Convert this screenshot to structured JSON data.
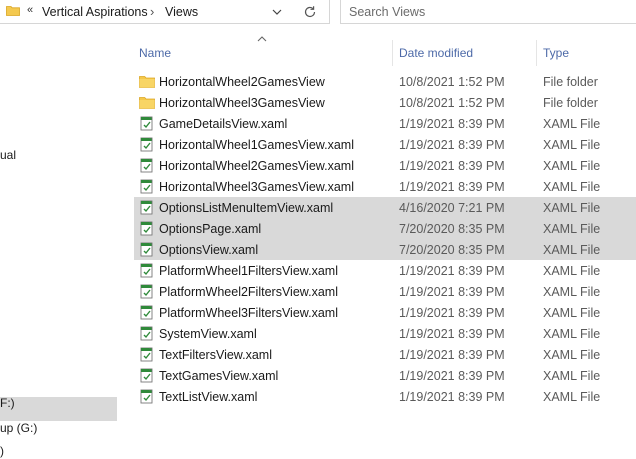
{
  "address": {
    "lead": "«",
    "crumbs": [
      "Vertical Aspirations",
      "Views"
    ],
    "separator": "›"
  },
  "search": {
    "placeholder": "Search Views"
  },
  "nav": {
    "partial_items": [
      {
        "label": "ual"
      },
      {
        "label": "F:)"
      },
      {
        "label": "up (G:)"
      },
      {
        "label": ")"
      }
    ]
  },
  "columns": {
    "name": "Name",
    "date": "Date modified",
    "type": "Type"
  },
  "files": [
    {
      "name": "HorizontalWheel2GamesView",
      "date": "10/8/2021 1:52 PM",
      "type": "File folder",
      "icon": "folder-icon",
      "selected": false
    },
    {
      "name": "HorizontalWheel3GamesView",
      "date": "10/8/2021 1:52 PM",
      "type": "File folder",
      "icon": "folder-icon",
      "selected": false
    },
    {
      "name": "GameDetailsView.xaml",
      "date": "1/19/2021 8:39 PM",
      "type": "XAML File",
      "icon": "xaml-file-icon",
      "selected": false
    },
    {
      "name": "HorizontalWheel1GamesView.xaml",
      "date": "1/19/2021 8:39 PM",
      "type": "XAML File",
      "icon": "xaml-file-icon",
      "selected": false
    },
    {
      "name": "HorizontalWheel2GamesView.xaml",
      "date": "1/19/2021 8:39 PM",
      "type": "XAML File",
      "icon": "xaml-file-icon",
      "selected": false
    },
    {
      "name": "HorizontalWheel3GamesView.xaml",
      "date": "1/19/2021 8:39 PM",
      "type": "XAML File",
      "icon": "xaml-file-icon",
      "selected": false
    },
    {
      "name": "OptionsListMenuItemView.xaml",
      "date": "4/16/2020 7:21 PM",
      "type": "XAML File",
      "icon": "xaml-file-icon",
      "selected": true
    },
    {
      "name": "OptionsPage.xaml",
      "date": "7/20/2020 8:35 PM",
      "type": "XAML File",
      "icon": "xaml-file-icon",
      "selected": true
    },
    {
      "name": "OptionsView.xaml",
      "date": "7/20/2020 8:35 PM",
      "type": "XAML File",
      "icon": "xaml-file-icon",
      "selected": true
    },
    {
      "name": "PlatformWheel1FiltersView.xaml",
      "date": "1/19/2021 8:39 PM",
      "type": "XAML File",
      "icon": "xaml-file-icon",
      "selected": false
    },
    {
      "name": "PlatformWheel2FiltersView.xaml",
      "date": "1/19/2021 8:39 PM",
      "type": "XAML File",
      "icon": "xaml-file-icon",
      "selected": false
    },
    {
      "name": "PlatformWheel3FiltersView.xaml",
      "date": "1/19/2021 8:39 PM",
      "type": "XAML File",
      "icon": "xaml-file-icon",
      "selected": false
    },
    {
      "name": "SystemView.xaml",
      "date": "1/19/2021 8:39 PM",
      "type": "XAML File",
      "icon": "xaml-file-icon",
      "selected": false
    },
    {
      "name": "TextFiltersView.xaml",
      "date": "1/19/2021 8:39 PM",
      "type": "XAML File",
      "icon": "xaml-file-icon",
      "selected": false
    },
    {
      "name": "TextGamesView.xaml",
      "date": "1/19/2021 8:39 PM",
      "type": "XAML File",
      "icon": "xaml-file-icon",
      "selected": false
    },
    {
      "name": "TextListView.xaml",
      "date": "1/19/2021 8:39 PM",
      "type": "XAML File",
      "icon": "xaml-file-icon",
      "selected": false
    }
  ]
}
